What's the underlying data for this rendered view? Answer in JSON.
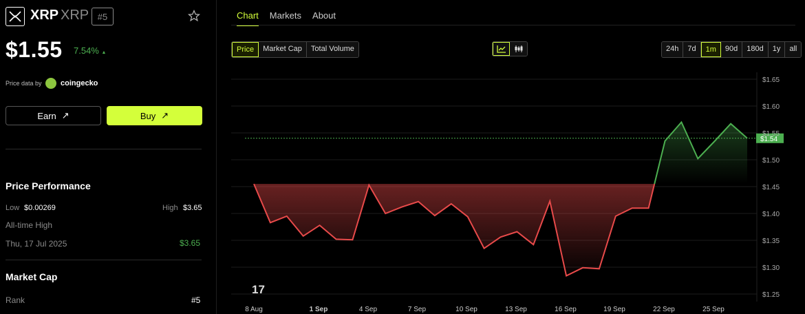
{
  "coin": {
    "name": "XRP",
    "symbol": "XRP",
    "rank": "#5"
  },
  "price": {
    "value": "$1.55",
    "change": "7.54%"
  },
  "price_source": {
    "prefix": "Price data by",
    "provider": "coingecko"
  },
  "buttons": {
    "earn": "Earn",
    "buy": "Buy"
  },
  "performance": {
    "title": "Price Performance",
    "low_label": "Low",
    "low_value": "$0.00269",
    "high_label": "High",
    "high_value": "$3.65",
    "ath_label": "All-time High",
    "ath_date": "Thu, 17 Jul 2025",
    "ath_value": "$3.65"
  },
  "market_cap": {
    "title": "Market Cap",
    "rank_label": "Rank",
    "rank_value": "#5"
  },
  "tabs": [
    "Chart",
    "Markets",
    "About"
  ],
  "metric_tabs": [
    "Price",
    "Market Cap",
    "Total Volume"
  ],
  "range_tabs": [
    "24h",
    "7d",
    "1m",
    "90d",
    "180d",
    "1y",
    "all"
  ],
  "active_metric": "Price",
  "active_range": "1m",
  "icons": {
    "logo": "xrp-logo-icon",
    "star": "star-icon",
    "earn": "arrow-up-right-icon",
    "line": "line-chart-icon",
    "candle": "candlestick-icon",
    "watermark": "tradingview-logo"
  },
  "colors": {
    "accent": "#d4ff3a",
    "up": "#4caf50",
    "down": "#e84a4a"
  },
  "chart_data": {
    "type": "area",
    "x_labels": [
      "8 Aug",
      "1 Sep",
      "4 Sep",
      "7 Sep",
      "10 Sep",
      "13 Sep",
      "16 Sep",
      "19 Sep",
      "22 Sep",
      "25 Sep"
    ],
    "y_ticks": [
      "$1.65",
      "$1.60",
      "$1.55",
      "$1.50",
      "$1.45",
      "$1.40",
      "$1.35",
      "$1.30",
      "$1.25"
    ],
    "ylim": [
      1.25,
      1.65
    ],
    "baseline": 1.455,
    "current_label": "$1.54",
    "current_value": 1.54,
    "values": [
      1.455,
      1.383,
      1.395,
      1.358,
      1.378,
      1.352,
      1.351,
      1.453,
      1.4,
      1.412,
      1.422,
      1.396,
      1.418,
      1.394,
      1.335,
      1.356,
      1.366,
      1.342,
      1.423,
      1.284,
      1.299,
      1.297,
      1.395,
      1.41,
      1.41,
      1.535,
      1.57,
      1.502,
      1.534,
      1.567,
      1.54
    ]
  }
}
